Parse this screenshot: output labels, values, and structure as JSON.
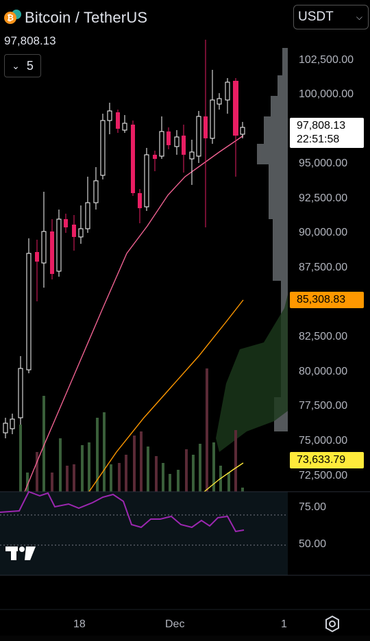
{
  "header": {
    "pair_title": "Bitcoin / TetherUS",
    "currency": "USDT",
    "last_price": "97,808.13",
    "interval": "5"
  },
  "price_axis": [
    "102,500.00",
    "100,000.00",
    "95,000.00",
    "92,500.00",
    "90,000.00",
    "87,500.00",
    "82,500.00",
    "80,000.00",
    "77,500.00",
    "75,000.00",
    "72,500.00"
  ],
  "price_tags": {
    "current_price": "97,808.13",
    "countdown": "22:51:58",
    "ma_orange": "85,308.83",
    "ma_yellow": "73,633.79"
  },
  "rsi_axis": [
    "75.00",
    "50.00"
  ],
  "time_axis": [
    "18",
    "Dec",
    "1"
  ],
  "colors": {
    "up": "#ffffff",
    "down": "#e91e63",
    "ma_pink": "#f06292",
    "ma_orange": "#ff9800",
    "ma_yellow": "#ffeb3b",
    "rsi": "#9c27b0"
  },
  "icons": {
    "coin": "bitcoin-icon",
    "settings": "gear-icon",
    "chevron": "chevron-down-icon"
  }
}
